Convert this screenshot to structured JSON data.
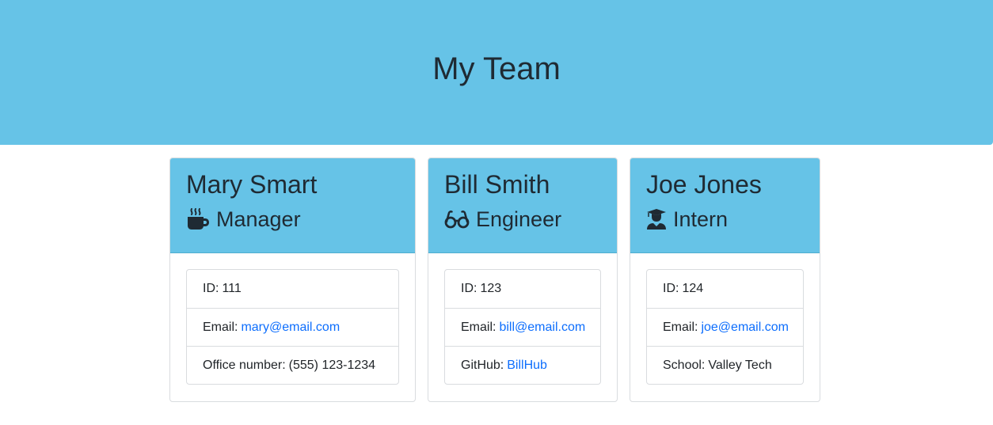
{
  "header": {
    "title": "My Team"
  },
  "colors": {
    "banner": "#66c3e7",
    "link": "#0d6efd"
  },
  "cards": [
    {
      "name": "Mary Smart",
      "role": "Manager",
      "role_icon": "coffee-mug-icon",
      "id_label": "ID:",
      "id": "111",
      "email_label": "Email:",
      "email": "mary@email.com",
      "extra_label": "Office number:",
      "extra_value": "(555) 123-1234"
    },
    {
      "name": "Bill Smith",
      "role": "Engineer",
      "role_icon": "glasses-icon",
      "id_label": "ID:",
      "id": "123",
      "email_label": "Email:",
      "email": "bill@email.com",
      "extra_label": "GitHub:",
      "extra_value": "BillHub"
    },
    {
      "name": "Joe Jones",
      "role": "Intern",
      "role_icon": "graduate-icon",
      "id_label": "ID:",
      "id": "124",
      "email_label": "Email:",
      "email": "joe@email.com",
      "extra_label": "School:",
      "extra_value": "Valley Tech"
    }
  ]
}
